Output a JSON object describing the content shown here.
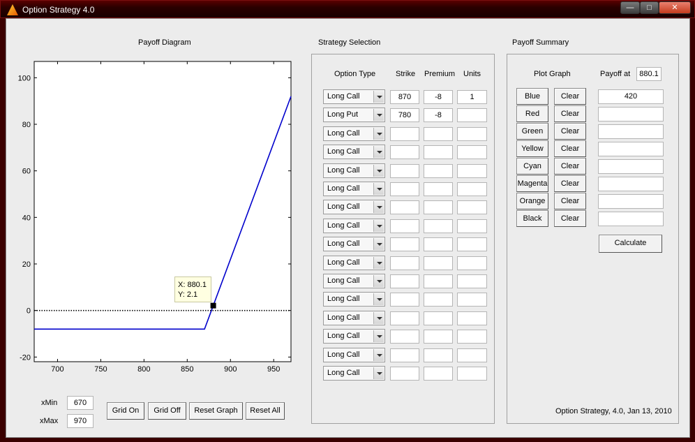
{
  "window": {
    "title": "Option Strategy 4.0",
    "controls": [
      "minimize",
      "maximize",
      "close"
    ]
  },
  "payoff_diagram": {
    "title": "Payoff Diagram",
    "datatip": {
      "x_text": "X: 880.1",
      "y_text": "Y: 2.1"
    },
    "xmin_label": "xMin",
    "xmax_label": "xMax",
    "xmin_value": "670",
    "xmax_value": "970",
    "buttons": {
      "grid_on": "Grid On",
      "grid_off": "Grid Off",
      "reset_graph": "Reset Graph",
      "reset_all": "Reset All"
    }
  },
  "chart_data": {
    "type": "line",
    "title": "",
    "xlabel": "",
    "ylabel": "",
    "xlim": [
      673,
      970
    ],
    "ylim": [
      -22,
      107
    ],
    "xticks": [
      700,
      750,
      800,
      850,
      900,
      950
    ],
    "yticks": [
      -20,
      0,
      20,
      40,
      60,
      80,
      100
    ],
    "grid": false,
    "series": [
      {
        "color": "#0000cc",
        "style": "solid",
        "x": [
          673,
          870,
          970
        ],
        "y": [
          -8,
          -8,
          92
        ]
      },
      {
        "color": "#000000",
        "style": "dotted",
        "x": [
          673,
          970
        ],
        "y": [
          0,
          0
        ]
      }
    ],
    "marker": {
      "x": 880.1,
      "y": 2.1
    }
  },
  "strategy_selection": {
    "title": "Strategy Selection",
    "headers": {
      "option_type": "Option Type",
      "strike": "Strike",
      "premium": "Premium",
      "units": "Units"
    },
    "rows": [
      {
        "type": "Long Call",
        "strike": "870",
        "premium": "-8",
        "units": "1"
      },
      {
        "type": "Long Put",
        "strike": "780",
        "premium": "-8",
        "units": ""
      },
      {
        "type": "Long Call",
        "strike": "",
        "premium": "",
        "units": ""
      },
      {
        "type": "Long Call",
        "strike": "",
        "premium": "",
        "units": ""
      },
      {
        "type": "Long Call",
        "strike": "",
        "premium": "",
        "units": ""
      },
      {
        "type": "Long Call",
        "strike": "",
        "premium": "",
        "units": ""
      },
      {
        "type": "Long Call",
        "strike": "",
        "premium": "",
        "units": ""
      },
      {
        "type": "Long Call",
        "strike": "",
        "premium": "",
        "units": ""
      },
      {
        "type": "Long Call",
        "strike": "",
        "premium": "",
        "units": ""
      },
      {
        "type": "Long Call",
        "strike": "",
        "premium": "",
        "units": ""
      },
      {
        "type": "Long Call",
        "strike": "",
        "premium": "",
        "units": ""
      },
      {
        "type": "Long Call",
        "strike": "",
        "premium": "",
        "units": ""
      },
      {
        "type": "Long Call",
        "strike": "",
        "premium": "",
        "units": ""
      },
      {
        "type": "Long Call",
        "strike": "",
        "premium": "",
        "units": ""
      },
      {
        "type": "Long Call",
        "strike": "",
        "premium": "",
        "units": ""
      },
      {
        "type": "Long Call",
        "strike": "",
        "premium": "",
        "units": ""
      }
    ]
  },
  "payoff_summary": {
    "title": "Payoff Summary",
    "plot_graph_label": "Plot Graph",
    "payoff_at_label": "Payoff at",
    "payoff_at_value": "880.1",
    "rows": [
      {
        "color": "Blue",
        "clear": "Clear",
        "payoff": "420"
      },
      {
        "color": "Red",
        "clear": "Clear",
        "payoff": ""
      },
      {
        "color": "Green",
        "clear": "Clear",
        "payoff": ""
      },
      {
        "color": "Yellow",
        "clear": "Clear",
        "payoff": ""
      },
      {
        "color": "Cyan",
        "clear": "Clear",
        "payoff": ""
      },
      {
        "color": "Magenta",
        "clear": "Clear",
        "payoff": ""
      },
      {
        "color": "Orange",
        "clear": "Clear",
        "payoff": ""
      },
      {
        "color": "Black",
        "clear": "Clear",
        "payoff": ""
      }
    ],
    "calculate": "Calculate",
    "footer": "Option Strategy, 4.0, Jan 13, 2010"
  }
}
